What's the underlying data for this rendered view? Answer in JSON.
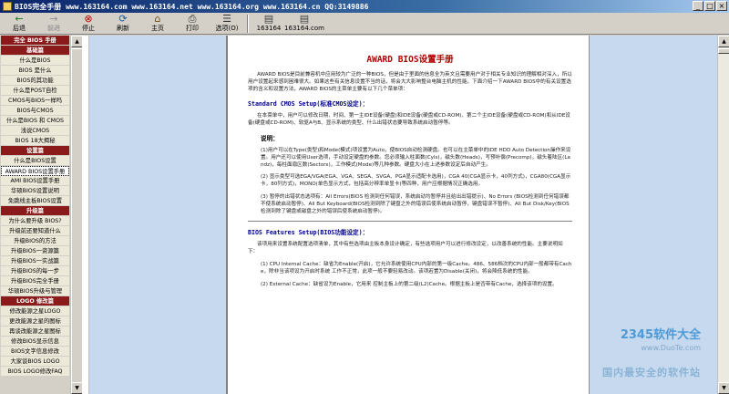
{
  "window": {
    "title": "BIOS完全手册 www.163164.com www.163164.net www.163164.org www.163164.cn QQ:3149886",
    "controls": {
      "minimize": "_",
      "maximize": "□",
      "close": "×"
    }
  },
  "toolbar": {
    "buttons": [
      {
        "label": "后退",
        "icon": "←",
        "disabled": false
      },
      {
        "label": "前进",
        "icon": "→",
        "disabled": true
      },
      {
        "label": "停止",
        "icon": "⊗",
        "disabled": false
      },
      {
        "label": "刷新",
        "icon": "⟳",
        "disabled": false
      },
      {
        "label": "主页",
        "icon": "⌂",
        "disabled": false
      },
      {
        "label": "打印",
        "icon": "⎙",
        "disabled": false
      },
      {
        "label": "选项(O)",
        "icon": "☰",
        "disabled": false
      },
      {
        "label": "163164",
        "icon": "▤",
        "disabled": false
      },
      {
        "label": "163164.com",
        "icon": "▤",
        "disabled": false
      }
    ]
  },
  "sidebar": {
    "items": [
      {
        "label": "完全 BIOS 手册",
        "type": "header"
      },
      {
        "label": "基础篇",
        "type": "header"
      },
      {
        "label": "什么是BIOS",
        "type": "item"
      },
      {
        "label": "BIOS 是什么",
        "type": "item"
      },
      {
        "label": "BIOS的其功能",
        "type": "item"
      },
      {
        "label": "什么是POST自检",
        "type": "item"
      },
      {
        "label": "CMOS与BIOS一样吗",
        "type": "item"
      },
      {
        "label": "BIOS与CMOS",
        "type": "item"
      },
      {
        "label": "什么是BIOS 和 CMOS",
        "type": "item"
      },
      {
        "label": "浅说CMOS",
        "type": "item"
      },
      {
        "label": "BIOS 18大揭秘",
        "type": "item"
      },
      {
        "label": "设置篇",
        "type": "header"
      },
      {
        "label": "什么是BIOS设置",
        "type": "item"
      },
      {
        "label": "AWARD BIOS设置手册",
        "type": "active"
      },
      {
        "label": "AMI BIOS设置手册",
        "type": "item"
      },
      {
        "label": "华硕BIOS设置说明",
        "type": "item"
      },
      {
        "label": "免跳线主板BIOS设置",
        "type": "item"
      },
      {
        "label": "升级篇",
        "type": "header"
      },
      {
        "label": "为什么要升级 BIOS?",
        "type": "item"
      },
      {
        "label": "升级前还要知道什么",
        "type": "item"
      },
      {
        "label": "升级BIOS的方法",
        "type": "item"
      },
      {
        "label": "升级BIOS一资源篇",
        "type": "item"
      },
      {
        "label": "升级BIOS一实战篇",
        "type": "item"
      },
      {
        "label": "升级BIOS的每一步",
        "type": "item"
      },
      {
        "label": "升级BIOS完全手册",
        "type": "item"
      },
      {
        "label": "华硕BIOS升级与管理",
        "type": "item"
      },
      {
        "label": "LOGO 修改篇",
        "type": "header"
      },
      {
        "label": "修改能源之星LOGO",
        "type": "item"
      },
      {
        "label": "更改能源之星的图标",
        "type": "item"
      },
      {
        "label": "再谈改能源之星图标",
        "type": "item"
      },
      {
        "label": "修改BIOS显示信息",
        "type": "item"
      },
      {
        "label": "BIOS文字信息修改",
        "type": "item"
      },
      {
        "label": "大家谈BIOS LOGO",
        "type": "item"
      },
      {
        "label": "BIOS LOGO修改FAQ",
        "type": "item"
      }
    ]
  },
  "content": {
    "title": "AWARD BIOS设置手册",
    "intro": "AWARD BIOS是目前兼容机中应用较为广泛的一种BIOS，但是由于里面的信息全为英文且需要用户对于相关专业知识的理解相对深入，所以用户设置起来感到困难很大。如果这些有关信息设置不当的话，将会大大影响整台电脑主机的性能。下面介绍一下AWARD BIOS中的有关设置选项的含义和设置方法，AWARD BIOS的主菜单主要有以下几个菜单项：",
    "sections": [
      {
        "heading": "Standard CMOS Setup(标准CMOS设定)：",
        "paragraphs": [
          "在本菜单中，用户可以修改日期、时间、第一主IDE设备(硬盘)和IDE设备(硬盘或CD-ROM)、第二个主IDE设备(硬盘或CD-ROM)和从IDE设备(硬盘或CD-ROM)、软驱A与B、显示系统的类型、什么出错状态要导致系统启动暂停等。"
        ]
      }
    ],
    "note_label": "说明：",
    "notes": [
      "(1)用户可以在Type(类型)和Mode(模式)项设置为Auto，使BIOS自动检测硬盘。也可以在主菜单中的IDE HDD Auto Detection操作来设置。用户还可以使用User选项，手动设定硬盘的参数。您必须输入柱面数(Cyls)，磁头数(Heads)，写预补偿(Precomp)，磁头着陆区(Landz)，每柱面扇区数(Sectors)，工作模式(Mode)等几种参数。硬盘大小在上述参数设定后自动产生。",
      "(2) 显示类型可选EGA/VGA(EGA、VGA、SEGA、SVGA、PGA显示适配卡选用)，CGA 40(CGA显示卡，40列方式)，CGA80(CGA显示卡，80列方式)，MONO(单色显示方式，包括高分辨率单显卡)等四种，用户应根据情况正确选用。",
      "(3) 暂停的出错状态选项有：All Errors(BIOS 检测到任何错误，系统启动均暂停并且给出出错提示)、No Errors (BIOS检测到任何错误都不使系统启动暂停)、All But Keyboard(BIOS检测到除了键盘之外的错误后使系统启动暂停，键盘错误不暂停)、All But Disk/Key(BIOS 检测到除了键盘或磁盘之外的错误后使系统启动暂停)。"
    ],
    "section2_heading": "BIOS Features Setup(BIOS功能设定)：",
    "section2_intro": "该项用来设置系统配置选项清单，其中有些选项由主板本身设计确定，有些选项用户可以进行修改设定，以改善系统的性能。主要说明如下：",
    "section2_items": [
      "(1) CPU Internal Cache：缺省为Enable(开启)，它允许系统使用CPU内部的第一级Cache。486、586档次的CPU内部一般都带有Cache，除非当该项设为开启时系统 工作不正常，此项一般不要轻易改动。该项若置为Disable(关闭)，将会降低系统的性能。",
      "(2) External Cache：缺省设为Enable，它用来 控制主板上的第二级(L2)Cache。根据主板上是否带有Cache，选择该项的设置。"
    ]
  },
  "watermark": {
    "brand": "2345软件大全",
    "site": "www.DuoTe.com",
    "brand2": "国内最安全的软件站"
  }
}
